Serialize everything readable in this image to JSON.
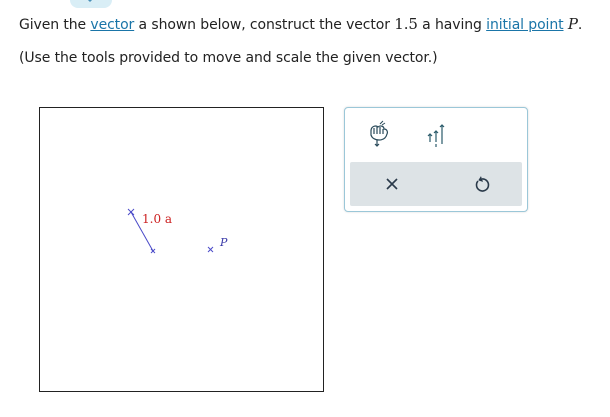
{
  "question": {
    "part1": "Given the ",
    "link_vector": "vector",
    "part2": " a shown below, construct the vector ",
    "scalar": "1.5",
    "part3": " a having ",
    "link_initial_point": "initial point",
    "part4": " ",
    "point_name": "P",
    "part5": ".",
    "instructions": "(Use the tools provided to move and scale the given vector.)"
  },
  "canvas": {
    "vector_label": "1.0 a",
    "point_label": "P"
  },
  "colors": {
    "vector": "#4a4ac8",
    "label_red": "#cc1f1f",
    "link": "#1a75a8",
    "toolbox_border": "#9bc7d8"
  },
  "toolbox": {
    "move_tool_icon": "hand-move-icon",
    "scale_tool_icon": "scale-arrows-icon",
    "clear_icon": "close-icon",
    "reset_icon": "reset-icon"
  }
}
